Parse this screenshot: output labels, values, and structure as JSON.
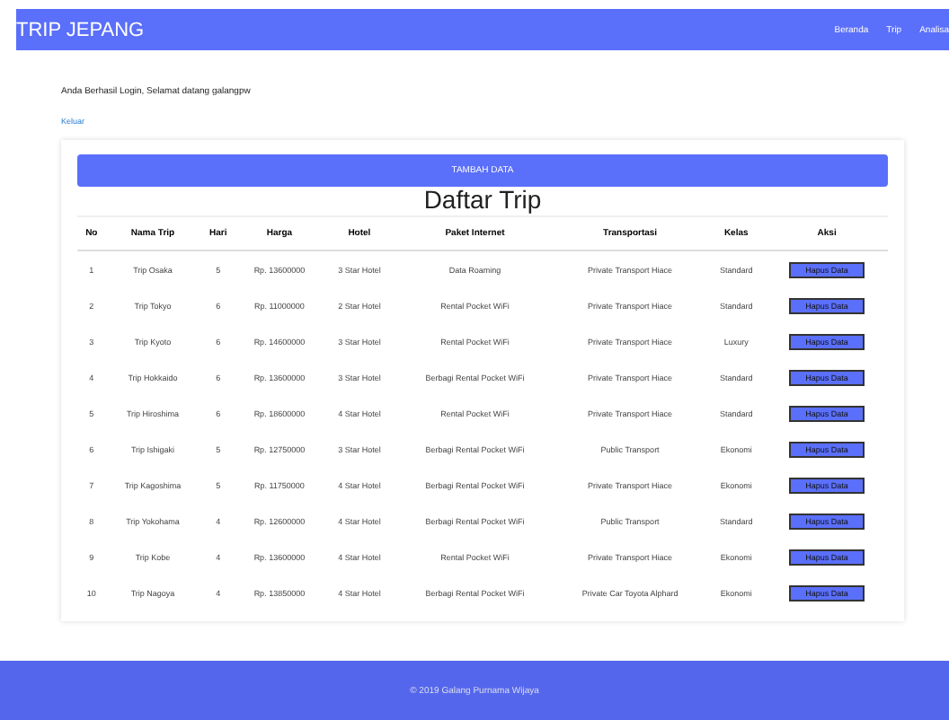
{
  "navbar": {
    "brand": "TRIP JEPANG",
    "links": [
      "Beranda",
      "Trip",
      "Analisa"
    ]
  },
  "welcome": "Anda Berhasil Login, Selamat datang galangpw",
  "logout": "Keluar",
  "add_button": "TAMBAH DATA",
  "table_title": "Daftar Trip",
  "table": {
    "columns": [
      "No",
      "Nama Trip",
      "Hari",
      "Harga",
      "Hotel",
      "Paket Internet",
      "Transportasi",
      "Kelas",
      "Aksi"
    ],
    "rows": [
      {
        "cells": [
          "1",
          "Trip Osaka",
          "5",
          "Rp. 13600000",
          "3 Star Hotel",
          "Data Roaming",
          "Private Transport Hiace",
          "Standard"
        ],
        "action": "Hapus Data"
      },
      {
        "cells": [
          "2",
          "Trip Tokyo",
          "6",
          "Rp. 11000000",
          "2 Star Hotel",
          "Rental Pocket WiFi",
          "Private Transport Hiace",
          "Standard"
        ],
        "action": "Hapus Data"
      },
      {
        "cells": [
          "3",
          "Trip Kyoto",
          "6",
          "Rp. 14600000",
          "3 Star Hotel",
          "Rental Pocket WiFi",
          "Private Transport Hiace",
          "Luxury"
        ],
        "action": "Hapus Data"
      },
      {
        "cells": [
          "4",
          "Trip Hokkaido",
          "6",
          "Rp. 13600000",
          "3 Star Hotel",
          "Berbagi Rental Pocket WiFi",
          "Private Transport Hiace",
          "Standard"
        ],
        "action": "Hapus Data"
      },
      {
        "cells": [
          "5",
          "Trip Hiroshima",
          "6",
          "Rp. 18600000",
          "4 Star Hotel",
          "Rental Pocket WiFi",
          "Private Transport Hiace",
          "Standard"
        ],
        "action": "Hapus Data"
      },
      {
        "cells": [
          "6",
          "Trip Ishigaki",
          "5",
          "Rp. 12750000",
          "3 Star Hotel",
          "Berbagi Rental Pocket WiFi",
          "Public Transport",
          "Ekonomi"
        ],
        "action": "Hapus Data"
      },
      {
        "cells": [
          "7",
          "Trip Kagoshima",
          "5",
          "Rp. 11750000",
          "4 Star Hotel",
          "Berbagi Rental Pocket WiFi",
          "Private Transport Hiace",
          "Ekonomi"
        ],
        "action": "Hapus Data"
      },
      {
        "cells": [
          "8",
          "Trip Yokohama",
          "4",
          "Rp. 12600000",
          "4 Star Hotel",
          "Berbagi Rental Pocket WiFi",
          "Public Transport",
          "Standard"
        ],
        "action": "Hapus Data"
      },
      {
        "cells": [
          "9",
          "Trip Kobe",
          "4",
          "Rp. 13600000",
          "4 Star Hotel",
          "Rental Pocket WiFi",
          "Private Transport Hiace",
          "Ekonomi"
        ],
        "action": "Hapus Data"
      },
      {
        "cells": [
          "10",
          "Trip Nagoya",
          "4",
          "Rp. 13850000",
          "4 Star Hotel",
          "Berbagi Rental Pocket WiFi",
          "Private Car Toyota Alphard",
          "Ekonomi"
        ],
        "action": "Hapus Data"
      }
    ]
  },
  "footer": "© 2019 Galang Purnama Wijaya"
}
